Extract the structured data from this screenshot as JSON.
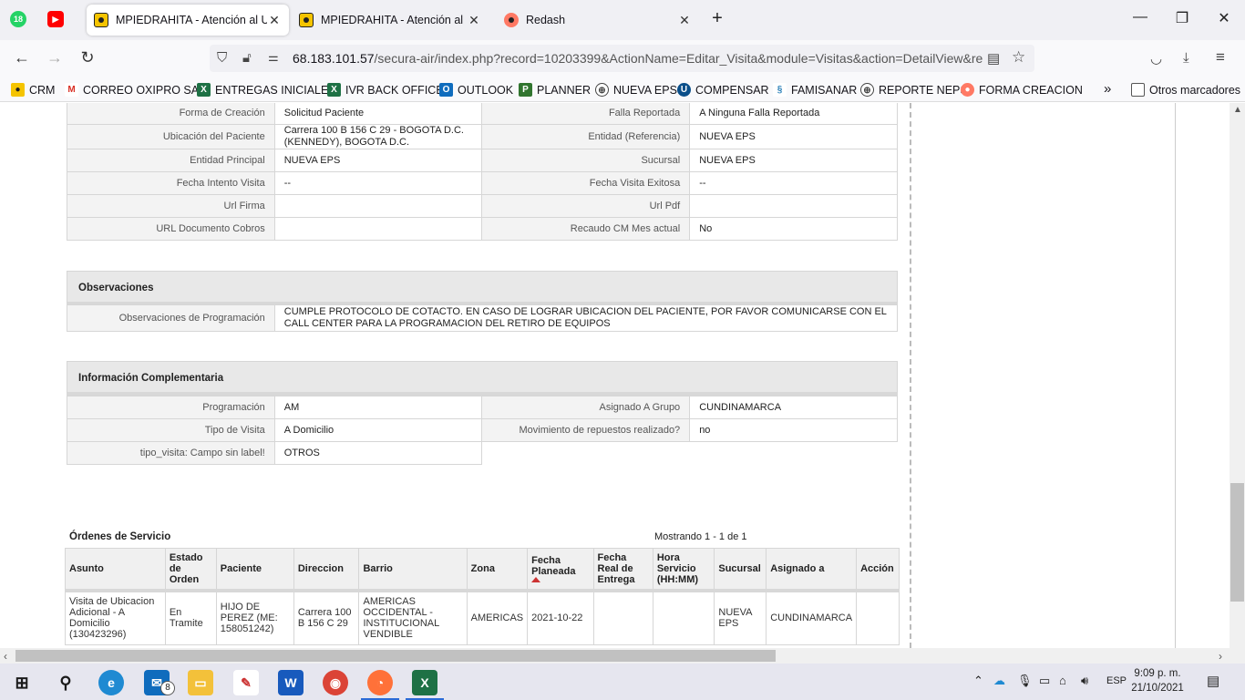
{
  "browser": {
    "pinned": [
      {
        "icon": "whatsapp-icon",
        "badge": "18",
        "color": "#25d366"
      },
      {
        "icon": "youtube-icon",
        "color": "#ff0000"
      }
    ],
    "tabs": [
      {
        "title": "MPIEDRAHITA - Atención al Usuario",
        "active": true
      },
      {
        "title": "MPIEDRAHITA - Atención al Usuario",
        "active": false
      },
      {
        "title": "Redash",
        "active": false
      }
    ],
    "url_host": "68.183.101.57",
    "url_rest": "/secura-air/index.php?record=10203399&ActionName=Editar_Visita&module=Visitas&action=DetailView&re",
    "bookmarks": [
      "CRM",
      "CORREO OXIPRO SAS",
      "ENTREGAS INICIALES",
      "IVR BACK OFFICE",
      "OUTLOOK",
      "PLANNER",
      "NUEVA EPS",
      "COMPENSAR",
      "FAMISANAR",
      "REPORTE NEPS",
      "FORMA CREACION"
    ],
    "other_bookmarks": "Otros marcadores"
  },
  "details": [
    {
      "l1": "Forma de Creación",
      "v1": "Solicitud Paciente",
      "l2": "Falla Reportada",
      "v2": "A Ninguna Falla Reportada"
    },
    {
      "l1": "Ubicación del Paciente",
      "v1": "Carrera 100 B 156 C 29 - BOGOTA D.C. (KENNEDY), BOGOTA D.C.",
      "l2": "Entidad (Referencia)",
      "v2": "NUEVA EPS"
    },
    {
      "l1": "Entidad Principal",
      "v1": "NUEVA EPS",
      "l2": "Sucursal",
      "v2": "NUEVA EPS"
    },
    {
      "l1": "Fecha Intento Visita",
      "v1": "--",
      "l2": "Fecha Visita Exitosa",
      "v2": "--"
    },
    {
      "l1": "Url Firma",
      "v1": "",
      "l2": "Url Pdf",
      "v2": ""
    },
    {
      "l1": "URL Documento Cobros",
      "v1": "",
      "l2": "Recaudo CM Mes actual",
      "v2": "No"
    }
  ],
  "observaciones": {
    "header": "Observaciones",
    "label": "Observaciones de Programación",
    "value": "CUMPLE PROTOCOLO DE COTACTO. EN CASO DE LOGRAR UBICACION DEL PACIENTE, POR FAVOR COMUNICARSE CON EL CALL CENTER PARA LA PROGRAMACION DEL RETIRO DE EQUIPOS"
  },
  "complementaria": {
    "header": "Información Complementaria",
    "rows": [
      {
        "l1": "Programación",
        "v1": "AM",
        "l2": "Asignado A Grupo",
        "v2": "CUNDINAMARCA"
      },
      {
        "l1": "Tipo de Visita",
        "v1": "A Domicilio",
        "l2": "Movimiento de repuestos realizado?",
        "v2": "no"
      },
      {
        "l1": "tipo_visita: Campo sin label!",
        "v1": "OTROS"
      }
    ]
  },
  "ordenes": {
    "title": "Órdenes de Servicio",
    "count": "Mostrando 1 - 1 de 1",
    "columns": [
      "Asunto",
      "Estado de Orden",
      "Paciente",
      "Direccion",
      "Barrio",
      "Zona",
      "Fecha Planeada",
      "Fecha Real de Entrega",
      "Hora Servicio (HH:MM)",
      "Sucursal",
      "Asignado a",
      "Acción"
    ],
    "row": [
      "Visita de Ubicacion Adicional - A Domicilio (130423296)",
      "En Tramite",
      "HIJO DE PEREZ (ME: 158051242)",
      "Carrera 100 B 156 C 29",
      "AMERICAS OCCIDENTAL - INSTITUCIONAL VENDIBLE",
      "AMERICAS",
      "2021-10-22",
      "",
      "",
      "NUEVA EPS",
      "CUNDINAMARCA",
      ""
    ]
  },
  "taskbar": {
    "apps": [
      "start-icon",
      "search-icon",
      "edge-icon",
      "mail-icon",
      "file-explorer-icon",
      "paint-icon",
      "word-icon",
      "chrome-icon",
      "firefox-icon",
      "excel-icon"
    ],
    "mail_badge": "8",
    "lang": "ESP",
    "time": "9:09 p. m.",
    "date": "21/10/2021"
  }
}
